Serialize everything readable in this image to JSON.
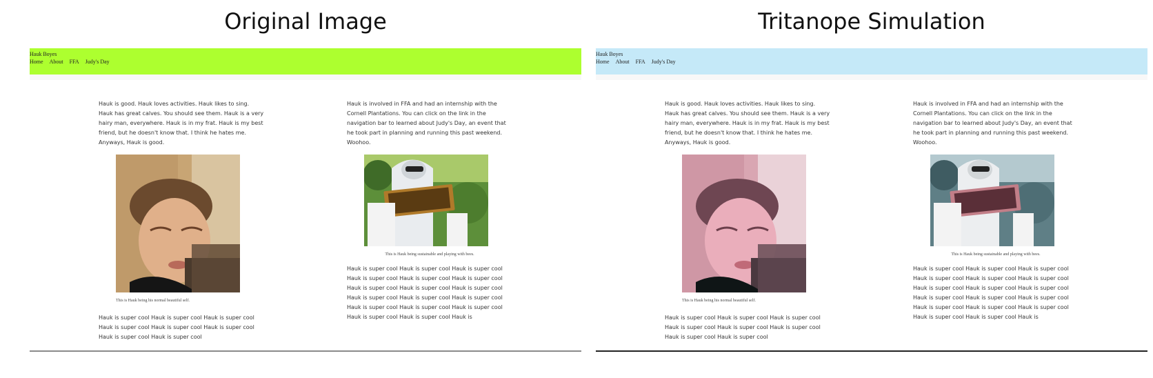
{
  "headings": {
    "left": "Original Image",
    "right": "Tritanope Simulation"
  },
  "site": {
    "brand": "Hauk Boyes",
    "nav": [
      "Home",
      "About",
      "FFA",
      "Judy's Day"
    ],
    "col1": {
      "intro": "Hauk is good. Hauk loves activities. Hauk likes to sing. Hauk has great calves. You should see them. Hauk is a very hairy man, everywhere. Hauk is in my frat. Hauk is my best friend, but he doesn't know that. I think he hates me. Anyways, Hauk is good.",
      "caption": "This is Hauk being his normal beautiful self.",
      "more": "Hauk is super cool Hauk is super cool Hauk is super cool Hauk is super cool Hauk is super cool Hauk is super cool Hauk is super cool Hauk is super cool"
    },
    "col2": {
      "intro": "Hauk is involved in FFA and had an internship with the Cornell Plantations. You can click on the link in the navigation bar to learned about Judy's Day, an event that he took part in planning and running this past weekend. Woohoo.",
      "caption": "This is Hauk being sustainable and playing with bees.",
      "more": "Hauk is super cool Hauk is super cool Hauk is super cool Hauk is super cool Hauk is super cool Hauk is super cool Hauk is super cool Hauk is super cool Hauk is super cool Hauk is super cool Hauk is super cool Hauk is super cool Hauk is super cool Hauk is super cool Hauk is super cool Hauk is super cool Hauk is super cool Hauk is"
    }
  },
  "colors": {
    "original_nav": "#adff2f",
    "tritanope_nav": "#c5e9f8"
  }
}
